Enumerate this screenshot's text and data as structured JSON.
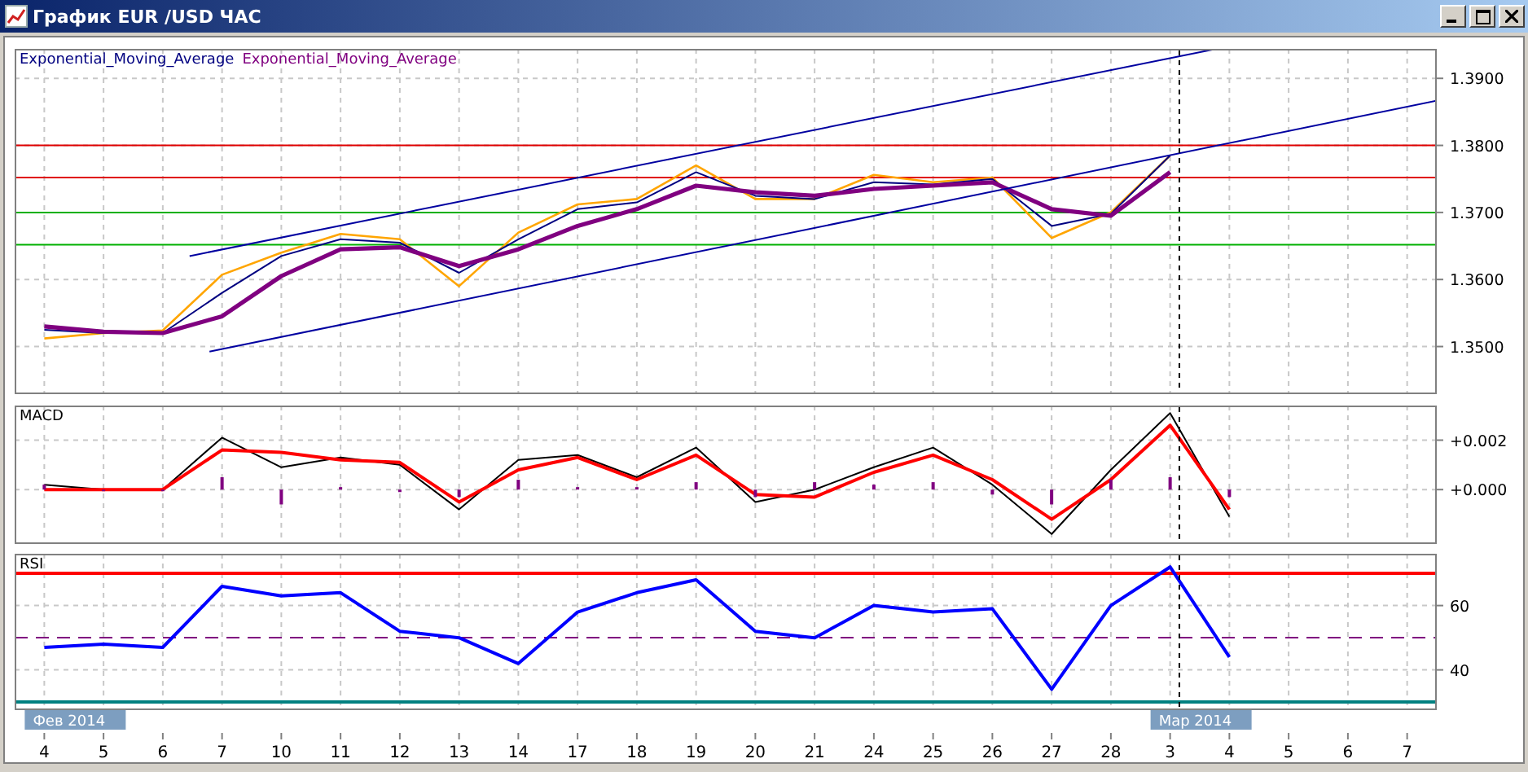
{
  "window": {
    "title": "График EUR /USD ЧАС"
  },
  "panels": [
    {
      "kind": "price",
      "chart_data": {
        "type": "line",
        "categories": [
          null,
          null,
          null,
          null,
          null,
          null,
          null,
          null,
          null,
          null,
          null,
          null,
          null,
          null,
          null,
          null,
          null,
          null,
          null,
          null,
          null,
          null,
          null,
          null
        ],
        "series": [
          {
            "color": "#ffa500",
            "values": [
              1.3512,
              1.352,
              1.3524,
              1.3607,
              1.364,
              1.3668,
              1.366,
              1.359,
              1.367,
              1.3712,
              1.372,
              1.377,
              1.372,
              1.372,
              1.3756,
              1.3745,
              1.3752,
              1.3662,
              1.37,
              1.3785,
              null,
              null,
              null,
              null
            ]
          },
          {
            "name": "Exponential_Moving_Average",
            "color": "#000080",
            "values": [
              1.3525,
              1.352,
              1.352,
              1.358,
              1.3635,
              1.366,
              1.3655,
              1.361,
              1.366,
              1.3705,
              1.3715,
              1.376,
              1.3725,
              1.372,
              1.3745,
              1.3742,
              1.375,
              1.368,
              1.3698,
              1.3785,
              null,
              null,
              null,
              null
            ]
          },
          {
            "name": "Exponential_Moving_Average",
            "color": "#800080",
            "values": [
              1.353,
              1.3522,
              1.352,
              1.3545,
              1.3605,
              1.3645,
              1.3648,
              1.362,
              1.3645,
              1.368,
              1.3705,
              1.374,
              1.373,
              1.3725,
              1.3735,
              1.374,
              1.3745,
              1.3705,
              1.3695,
              1.376,
              null,
              null,
              null,
              null
            ]
          }
        ],
        "ylim": [
          1.3429,
          1.3944
        ],
        "yticks": [
          {
            "value": 1.35,
            "label": "1.3500"
          },
          {
            "value": 1.36,
            "label": "1.3600"
          },
          {
            "value": 1.37,
            "label": "1.3700"
          },
          {
            "value": 1.38,
            "label": "1.3800"
          },
          {
            "value": 1.39,
            "label": "1.3900"
          }
        ],
        "grid": true,
        "ref_lines": [
          {
            "axis": "y",
            "value": 1.38,
            "color": "#e00000"
          },
          {
            "axis": "y",
            "value": 1.3752,
            "color": "#e00000"
          },
          {
            "axis": "y",
            "value": 1.37,
            "color": "#00b000"
          },
          {
            "axis": "y",
            "value": 1.3652,
            "color": "#00b000"
          }
        ]
      }
    },
    {
      "kind": "macd",
      "chart_data": {
        "type": "line",
        "title": "MACD",
        "categories": [
          null,
          null,
          null,
          null,
          null,
          null,
          null,
          null,
          null,
          null,
          null,
          null,
          null,
          null,
          null,
          null,
          null,
          null,
          null,
          null,
          null,
          null,
          null,
          null
        ],
        "series": [
          {
            "color": "#000000",
            "values": [
              0.0002,
              0,
              0,
              0.0021,
              0.0009,
              0.0013,
              0.001,
              -0.0008,
              0.0012,
              0.0014,
              0.0005,
              0.0017,
              -0.0005,
              0,
              0.0009,
              0.0017,
              0.0002,
              -0.0018,
              0.0008,
              0.0031,
              -0.0011,
              null,
              null,
              null
            ]
          },
          {
            "color": "#ff0000",
            "values": [
              0,
              0,
              0,
              0.0016,
              0.0015,
              0.0012,
              0.0011,
              -0.0005,
              0.0008,
              0.0013,
              0.0004,
              0.0014,
              -0.0002,
              -0.0003,
              0.0007,
              0.0014,
              0.0004,
              -0.0012,
              0.0004,
              0.0026,
              -0.0008,
              null,
              null,
              null
            ]
          }
        ],
        "ylim": [
          -0.0022,
          0.0034
        ],
        "yticks": [
          {
            "value": 0,
            "label": "+0.000"
          },
          {
            "value": 0.002,
            "label": "+0.002"
          }
        ],
        "grid": true
      }
    },
    {
      "kind": "rsi",
      "chart_data": {
        "type": "line",
        "title": "RSI",
        "categories": [
          "4",
          "5",
          "6",
          "7",
          "10",
          "11",
          "12",
          "13",
          "14",
          "17",
          "18",
          "19",
          "20",
          "21",
          "24",
          "25",
          "26",
          "27",
          "28",
          "3",
          "4",
          "5",
          "6",
          "7"
        ],
        "series": [
          {
            "color": "#0000ff",
            "values": [
              47,
              48,
              47,
              66,
              63,
              64,
              52,
              50,
              42,
              58,
              64,
              68,
              52,
              50,
              60,
              58,
              59,
              34,
              60,
              72,
              44,
              null,
              null,
              null
            ]
          }
        ],
        "ylim": [
          27.5,
          76.1
        ],
        "yticks": [
          40,
          60
        ],
        "grid": true,
        "ref_lines": [
          {
            "axis": "y",
            "value": 70,
            "color": "#ff0000"
          },
          {
            "axis": "y",
            "value": 50,
            "color": "#800080"
          },
          {
            "axis": "y",
            "value": 30,
            "color": "#008080"
          }
        ]
      }
    }
  ],
  "month_labels": [
    {
      "label": "Фев 2014"
    },
    {
      "label": "Мар 2014"
    }
  ]
}
